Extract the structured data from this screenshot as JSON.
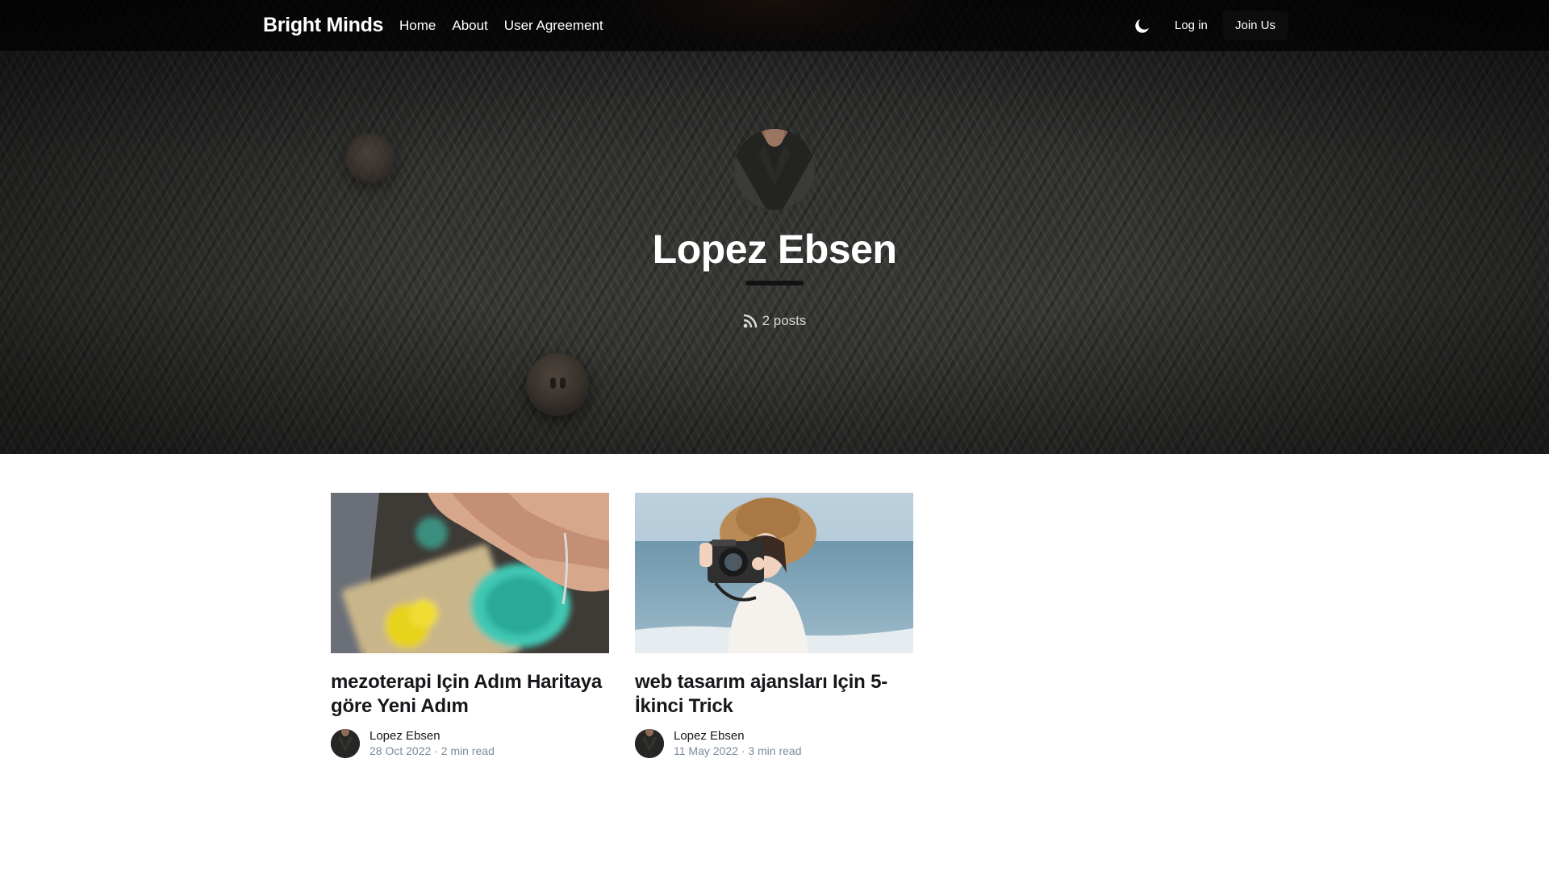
{
  "nav": {
    "brand": "Bright Minds",
    "links": [
      "Home",
      "About",
      "User Agreement"
    ],
    "theme_icon": "moon-icon",
    "login_label": "Log in",
    "join_label": "Join Us"
  },
  "author": {
    "name": "Lopez Ebsen",
    "posts_icon": "rss-icon",
    "post_count": "2 posts"
  },
  "posts": [
    {
      "title": "mezoterapi Için Adım Haritaya göre Yeni Adım",
      "author": "Lopez Ebsen",
      "meta": "28 Oct 2022 · 2 min read"
    },
    {
      "title": "web tasarım ajansları Için 5-İkinci Trick",
      "author": "Lopez Ebsen",
      "meta": "11 May 2022 · 3 min read"
    }
  ],
  "colors": {
    "text": "#15171a",
    "muted": "#7c8b9a",
    "nav_bg": "#000000"
  }
}
